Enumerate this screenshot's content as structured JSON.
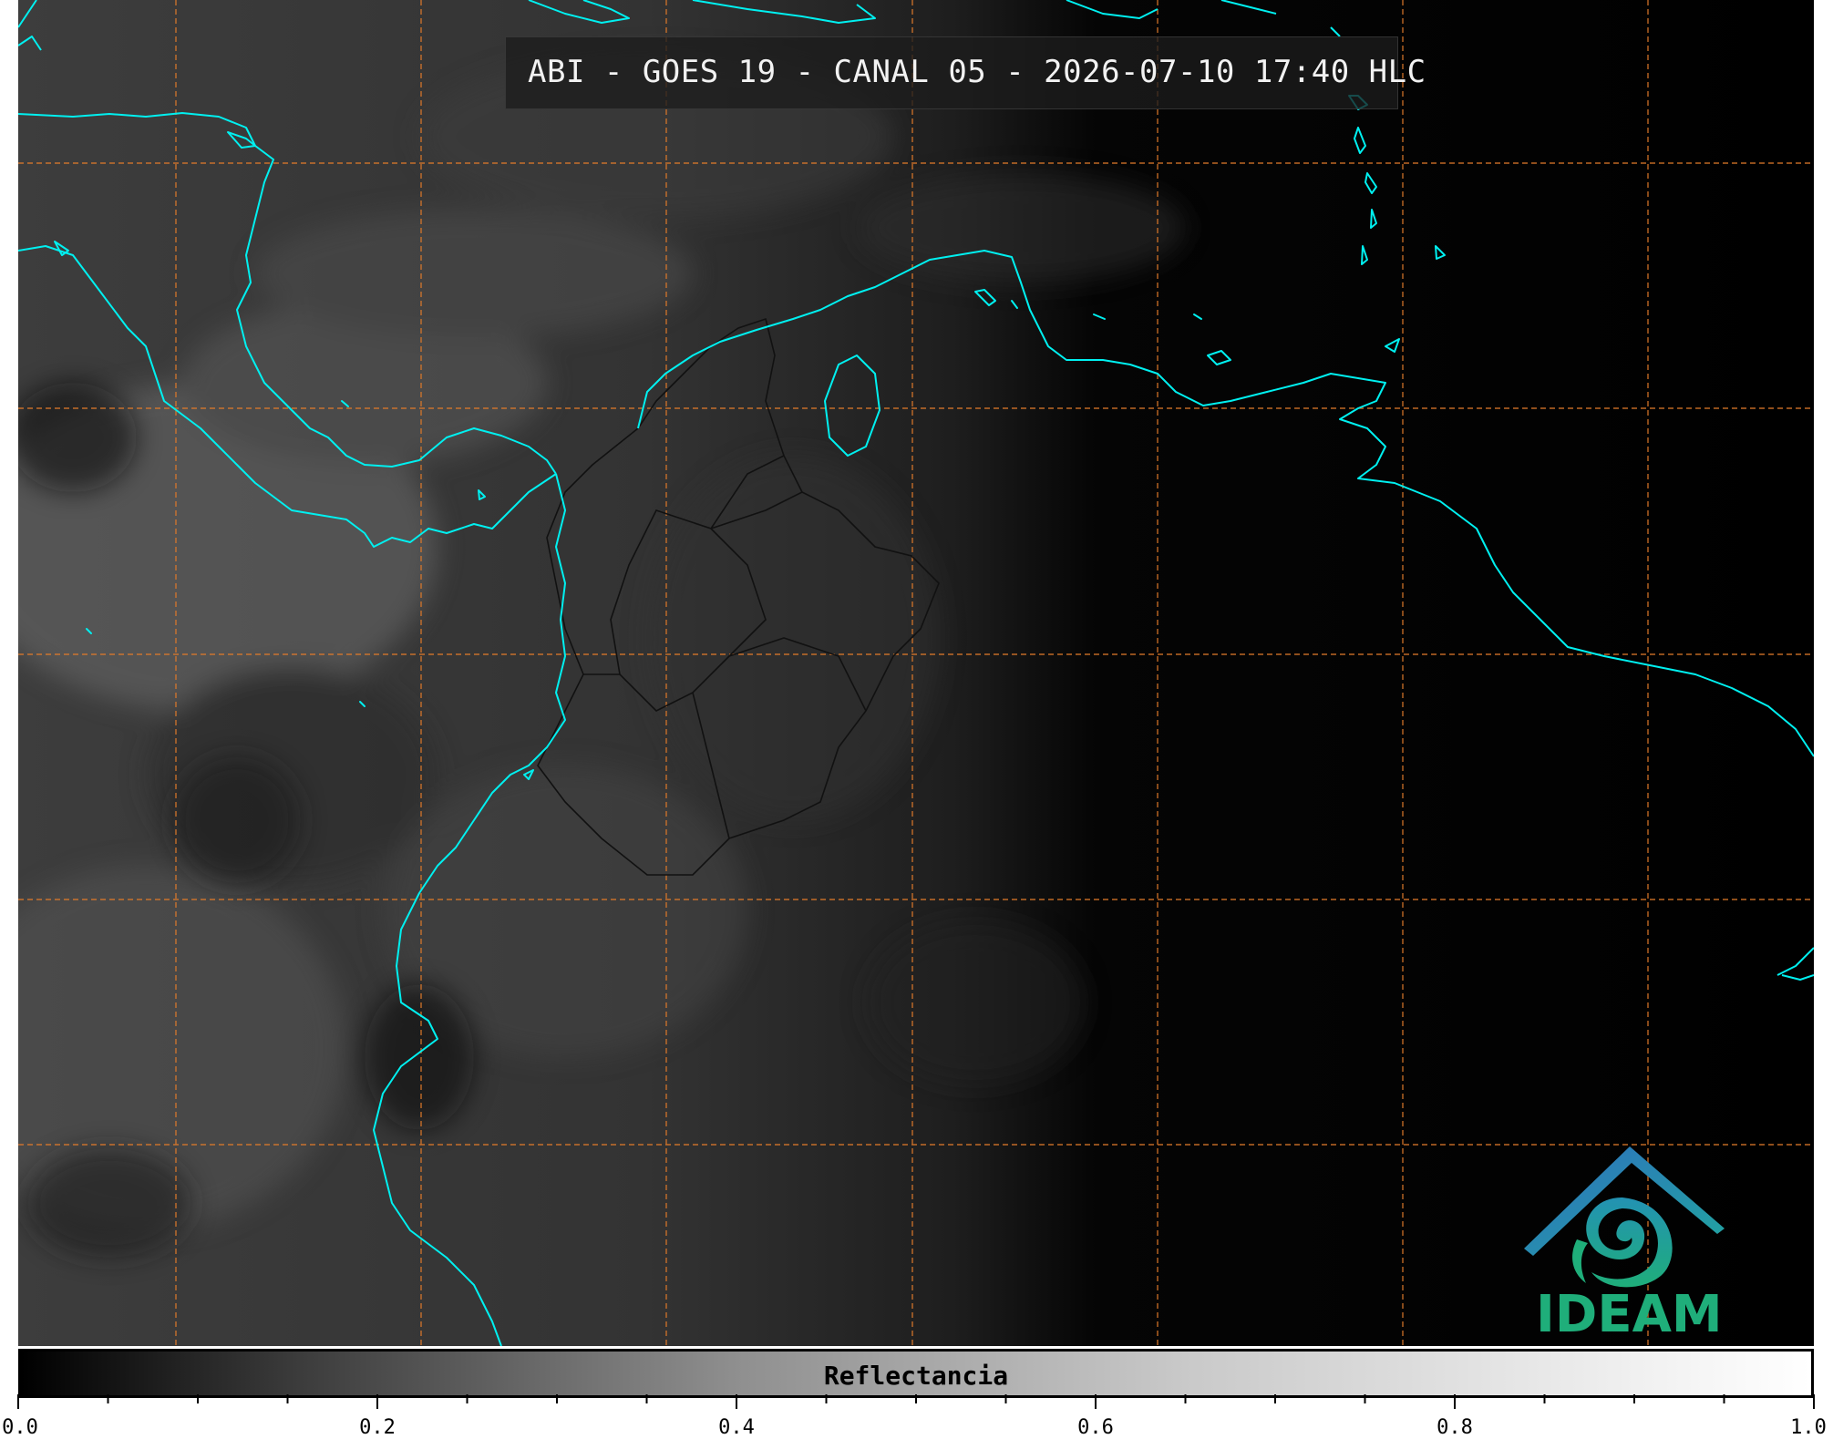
{
  "title": "ABI - GOES 19 - CANAL 05 - 2026-07-10 17:40 HLC",
  "logo": {
    "text": "IDEAM",
    "icon": "ideam-logo-icon",
    "colors": {
      "arc": "#2e7fb8",
      "swirl": "#1fae7a"
    }
  },
  "colorbar": {
    "label": "Reflectancia",
    "min": 0.0,
    "max": 1.0,
    "tick_labels": [
      "0.0",
      "0.2",
      "0.4",
      "0.6",
      "0.8",
      "1.0"
    ],
    "tick_values": [
      0.0,
      0.2,
      0.4,
      0.6,
      0.8,
      1.0
    ],
    "minor_step": 0.05
  },
  "colors": {
    "coastline": "#00f0f0",
    "grid": "#e07a2a",
    "borders": "#111111"
  },
  "map": {
    "grid": true,
    "grid_style": "dashed"
  }
}
